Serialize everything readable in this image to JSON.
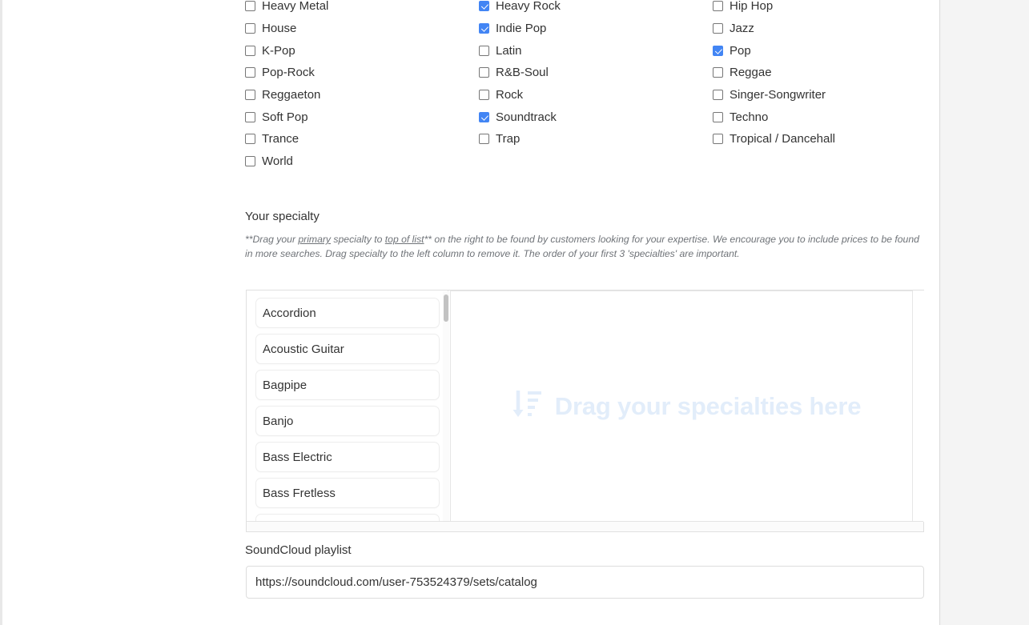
{
  "genres": {
    "columns": [
      [
        {
          "label": "Heavy Metal",
          "checked": false
        },
        {
          "label": "House",
          "checked": false
        },
        {
          "label": "K-Pop",
          "checked": false
        },
        {
          "label": "Pop-Rock",
          "checked": false
        },
        {
          "label": "Reggaeton",
          "checked": false
        },
        {
          "label": "Soft Pop",
          "checked": false
        },
        {
          "label": "Trance",
          "checked": false
        },
        {
          "label": "World",
          "checked": false
        }
      ],
      [
        {
          "label": "Heavy Rock",
          "checked": true
        },
        {
          "label": "Indie Pop",
          "checked": true
        },
        {
          "label": "Latin",
          "checked": false
        },
        {
          "label": "R&B-Soul",
          "checked": false
        },
        {
          "label": "Rock",
          "checked": false
        },
        {
          "label": "Soundtrack",
          "checked": true
        },
        {
          "label": "Trap",
          "checked": false
        }
      ],
      [
        {
          "label": "Hip Hop",
          "checked": false
        },
        {
          "label": "Jazz",
          "checked": false
        },
        {
          "label": "Pop",
          "checked": true
        },
        {
          "label": "Reggae",
          "checked": false
        },
        {
          "label": "Singer-Songwriter",
          "checked": false
        },
        {
          "label": "Techno",
          "checked": false
        },
        {
          "label": "Tropical / Dancehall",
          "checked": false
        }
      ]
    ]
  },
  "specialty": {
    "title": "Your specialty",
    "note_parts": [
      {
        "text": "**Drag your ",
        "underline": false
      },
      {
        "text": "primary",
        "underline": true
      },
      {
        "text": " specialty to ",
        "underline": false
      },
      {
        "text": "top of list",
        "underline": true
      },
      {
        "text": "** on the right to be found by customers looking for your expertise. We encourage you to include prices to be found in more searches. Drag specialty to the left column to remove it. The order of your first 3 'specialties' are important.",
        "underline": false
      }
    ],
    "available": [
      "Accordion",
      "Acoustic Guitar",
      "Bagpipe",
      "Banjo",
      "Bass Electric",
      "Bass Fretless"
    ],
    "dropzone_placeholder": "Drag your specialties here",
    "dropzone_icon": "sort-descending-icon",
    "selected": []
  },
  "soundcloud": {
    "label": "SoundCloud playlist",
    "value": "https://soundcloud.com/user-753524379/sets/catalog",
    "placeholder": "https://soundcloud.com/..."
  },
  "colors": {
    "checkbox_checked": "#4285f4",
    "dropzone_text": "#e2edfa",
    "text": "#333333",
    "note_text": "#6f7378"
  }
}
